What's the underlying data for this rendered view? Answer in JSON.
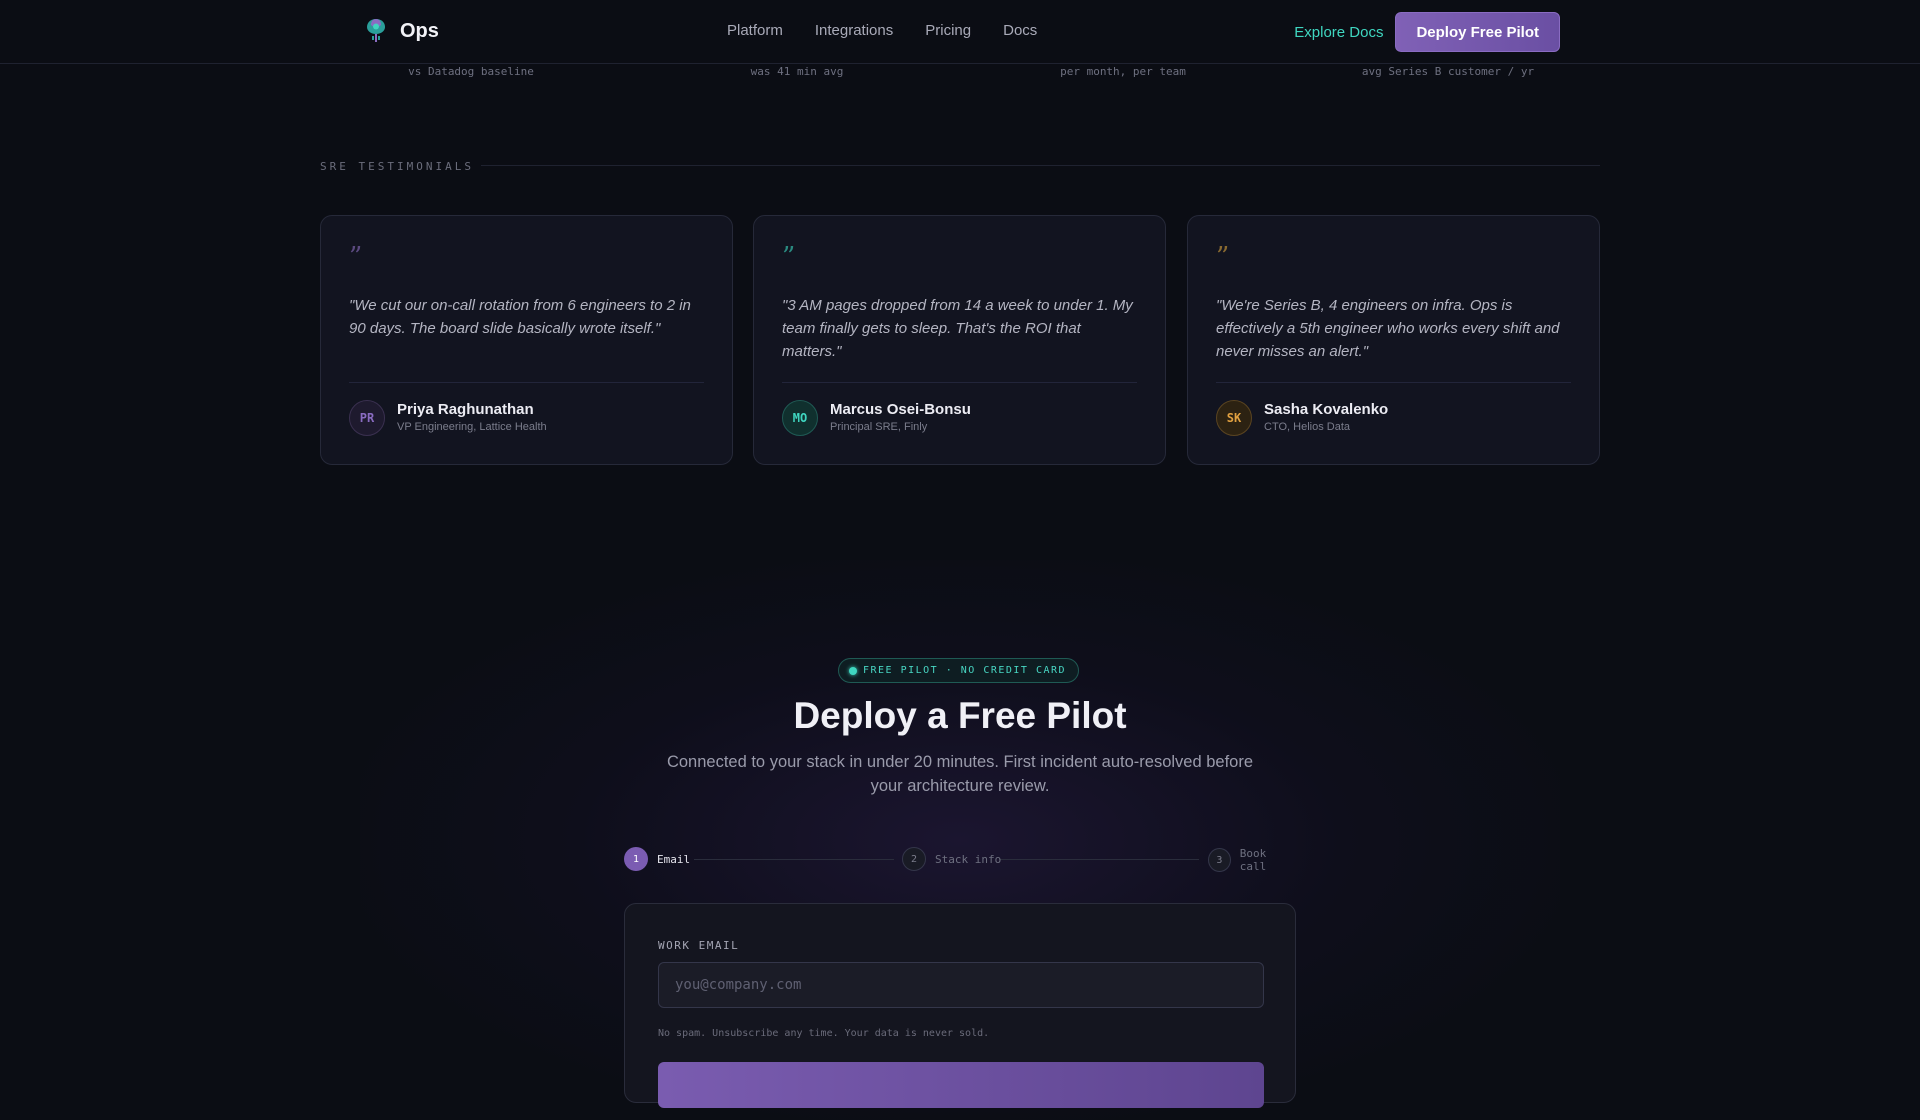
{
  "nav": {
    "brand": "Ops",
    "links": [
      "Platform",
      "Integrations",
      "Pricing",
      "Docs"
    ],
    "explore_label": "Explore Docs",
    "deploy_label": "Deploy Free Pilot"
  },
  "stats": {
    "captions": [
      "vs Datadog baseline",
      "was 41 min avg",
      "per month, per team",
      "avg Series B customer / yr"
    ]
  },
  "testimonials": {
    "section_label": "SRE TESTIMONIALS",
    "items": [
      {
        "quote_mark": "”",
        "quote": "\"We cut our on-call rotation from 6 engineers to 2 in 90 days. The board slide basically wrote itself.\"",
        "initials": "PR",
        "name": "Priya Raghunathan",
        "role": "VP Engineering, Lattice Health",
        "accent": "#8a6cc2"
      },
      {
        "quote_mark": "”",
        "quote": "\"3 AM pages dropped from 14 a week to under 1. My team finally gets to sleep. That's the ROI that matters.\"",
        "initials": "MO",
        "name": "Marcus Osei-Bonsu",
        "role": "Principal SRE, Finly",
        "accent": "#3fd6c0"
      },
      {
        "quote_mark": "”",
        "quote": "\"We're Series B, 4 engineers on infra. Ops is effectively a 5th engineer who works every shift and never misses an alert.\"",
        "initials": "SK",
        "name": "Sasha Kovalenko",
        "role": "CTO, Helios Data",
        "accent": "#e0a040"
      }
    ]
  },
  "cta": {
    "badge": "FREE PILOT · NO CREDIT CARD",
    "title": "Deploy a Free Pilot",
    "subtitle": "Connected to your stack in under 20 minutes. First incident auto-resolved before your architecture review.",
    "steps": [
      {
        "num": "1",
        "label": "Email"
      },
      {
        "num": "2",
        "label": "Stack info"
      },
      {
        "num": "3",
        "label": "Book call"
      }
    ],
    "active_step": 1,
    "form": {
      "label": "WORK EMAIL",
      "placeholder": "you@company.com",
      "value": "",
      "note": "No spam. Unsubscribe any time. Your data is never sold."
    }
  },
  "colors": {
    "accent_purple": "#8061b6",
    "accent_teal": "#3fd6c0",
    "accent_amber": "#e0a040",
    "background": "#0b0d14"
  }
}
